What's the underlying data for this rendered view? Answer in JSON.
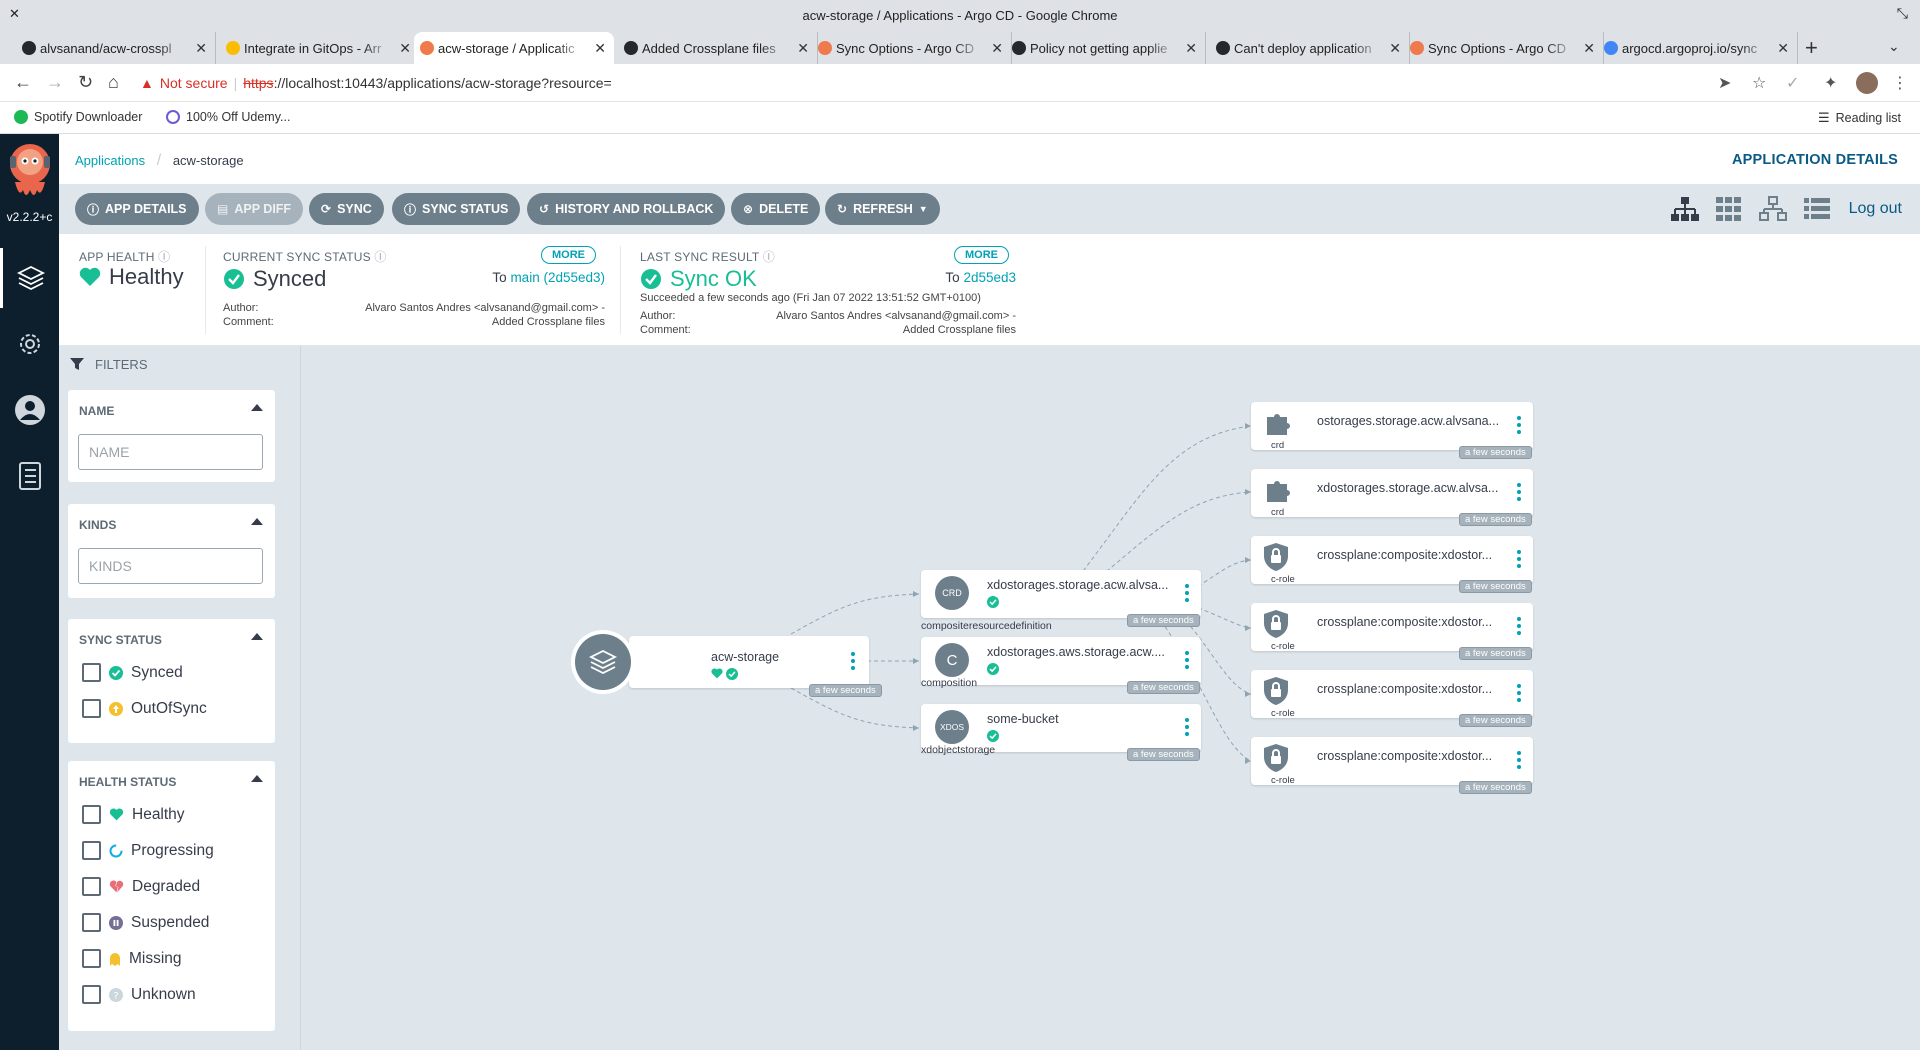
{
  "window": {
    "title": "acw-storage / Applications - Argo CD - Google Chrome"
  },
  "tabs": [
    {
      "label": "alvsanand/acw-crosspl",
      "icon": "github-icon",
      "color": "#24292e"
    },
    {
      "label": "Integrate in GitOps - Arr",
      "icon": "docs-icon",
      "color": "#fbbc04"
    },
    {
      "label": "acw-storage / Applicatic",
      "icon": "argo-icon",
      "color": "#ef7b4d"
    },
    {
      "label": "Added Crossplane files",
      "icon": "github-icon",
      "color": "#24292e"
    },
    {
      "label": "Sync Options - Argo CD",
      "icon": "argo-icon",
      "color": "#ef7b4d"
    },
    {
      "label": "Policy not getting applie",
      "icon": "github-icon",
      "color": "#24292e"
    },
    {
      "label": "Can't deploy application",
      "icon": "github-icon",
      "color": "#24292e"
    },
    {
      "label": "Sync Options - Argo CD",
      "icon": "argo-icon",
      "color": "#ef7b4d"
    },
    {
      "label": "argocd.argoproj.io/sync",
      "icon": "google-icon",
      "color": "#4285f4"
    }
  ],
  "address": {
    "warning": "Not secure",
    "scheme": "https",
    "rest": "://localhost:10443/applications/acw-storage?resource="
  },
  "bookmarks": [
    {
      "label": "Spotify Downloader",
      "color": "#1db954"
    },
    {
      "label": "100% Off Udemy...",
      "color": "#6b5bd6"
    }
  ],
  "reading_list": "Reading list",
  "sidebar": {
    "version": "v2.2.2+c"
  },
  "breadcrumb": {
    "root": "Applications",
    "current": "acw-storage"
  },
  "page_heading": "APPLICATION DETAILS",
  "toolbar": {
    "buttons": [
      {
        "label": "APP DETAILS",
        "icon": "info-icon",
        "disabled": false
      },
      {
        "label": "APP DIFF",
        "icon": "file-icon",
        "disabled": true
      },
      {
        "label": "SYNC",
        "icon": "sync-icon",
        "disabled": false
      },
      {
        "label": "SYNC STATUS",
        "icon": "info-icon",
        "disabled": false
      },
      {
        "label": "HISTORY AND ROLLBACK",
        "icon": "history-icon",
        "disabled": false
      },
      {
        "label": "DELETE",
        "icon": "delete-icon",
        "disabled": false
      },
      {
        "label": "REFRESH",
        "icon": "refresh-icon",
        "disabled": false
      }
    ],
    "logout": "Log out"
  },
  "status": {
    "health": {
      "label": "APP HEALTH",
      "value": "Healthy"
    },
    "sync": {
      "label": "CURRENT SYNC STATUS",
      "value": "Synced",
      "more": "MORE",
      "to_prefix": "To",
      "to": "main (2d55ed3)",
      "author_label": "Author:",
      "author": "Alvaro Santos Andres <alvsanand@gmail.com> -",
      "comment_label": "Comment:",
      "comment": "Added Crossplane files"
    },
    "last": {
      "label": "LAST SYNC RESULT",
      "value": "Sync OK",
      "more": "MORE",
      "to_prefix": "To",
      "to": "2d55ed3",
      "succeeded": "Succeeded a few seconds ago (Fri Jan 07 2022 13:51:52 GMT+0100)",
      "author_label": "Author:",
      "author": "Alvaro Santos Andres <alvsanand@gmail.com> -",
      "comment_label": "Comment:",
      "comment": "Added Crossplane files"
    }
  },
  "filters": {
    "title": "FILTERS",
    "name": {
      "header": "NAME",
      "placeholder": "NAME"
    },
    "kinds": {
      "header": "KINDS",
      "placeholder": "KINDS"
    },
    "sync_status": {
      "header": "SYNC STATUS",
      "items": [
        "Synced",
        "OutOfSync"
      ]
    },
    "health_status": {
      "header": "HEALTH STATUS",
      "items": [
        "Healthy",
        "Progressing",
        "Degraded",
        "Suspended",
        "Missing",
        "Unknown"
      ]
    }
  },
  "graph": {
    "app": {
      "name": "acw-storage",
      "age": "a few seconds"
    },
    "middle": [
      {
        "name": "xdostorages.storage.acw.alvsa...",
        "kind": "compositeresourcedefinition",
        "abbr": "CRD",
        "age": "a few seconds"
      },
      {
        "name": "xdostorages.aws.storage.acw....",
        "kind": "composition",
        "abbr": "C",
        "age": "a few seconds"
      },
      {
        "name": "some-bucket",
        "kind": "xdobjectstorage",
        "abbr": "XDOS",
        "age": "a few seconds"
      }
    ],
    "right": [
      {
        "name": "ostorages.storage.acw.alvsana...",
        "kind": "crd",
        "icon": "puzzle-icon",
        "age": "a few seconds"
      },
      {
        "name": "xdostorages.storage.acw.alvsa...",
        "kind": "crd",
        "icon": "puzzle-icon",
        "age": "a few seconds"
      },
      {
        "name": "crossplane:composite:xdostor...",
        "kind": "c-role",
        "icon": "shield-lock-icon",
        "age": "a few seconds"
      },
      {
        "name": "crossplane:composite:xdostor...",
        "kind": "c-role",
        "icon": "shield-lock-icon",
        "age": "a few seconds"
      },
      {
        "name": "crossplane:composite:xdostor...",
        "kind": "c-role",
        "icon": "shield-lock-icon",
        "age": "a few seconds"
      },
      {
        "name": "crossplane:composite:xdostor...",
        "kind": "c-role",
        "icon": "shield-lock-icon",
        "age": "a few seconds"
      }
    ]
  },
  "colors": {
    "accent": "#00a2b3",
    "healthy": "#18be94",
    "dark_nav": "#0d1e2d",
    "button": "#6d7f8b"
  }
}
